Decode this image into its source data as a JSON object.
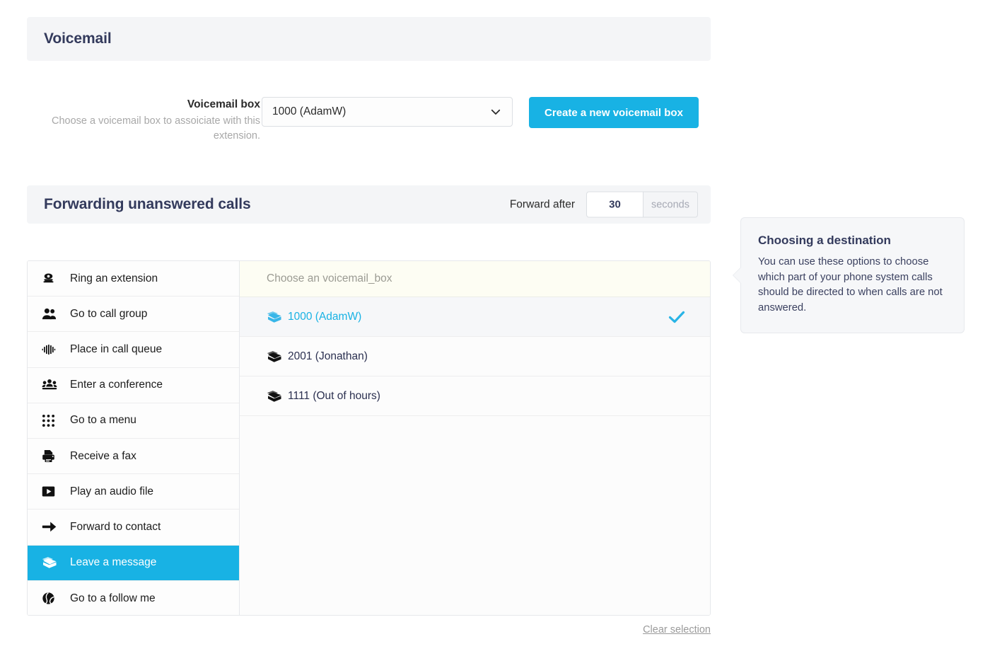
{
  "voicemail_section": {
    "title": "Voicemail",
    "field_label": "Voicemail box",
    "field_help": "Choose a voicemail box to assoiciate with this extension.",
    "selected_box": "1000 (AdamW)",
    "create_button": "Create a new voicemail box"
  },
  "forwarding_section": {
    "title": "Forwarding unanswered calls",
    "forward_after_label": "Forward after",
    "forward_after_value": "30",
    "forward_after_unit": "seconds"
  },
  "destinations": [
    {
      "label": "Ring an extension",
      "icon": "telephone-icon",
      "active": false
    },
    {
      "label": "Go to call group",
      "icon": "users-icon",
      "active": false
    },
    {
      "label": "Place in call queue",
      "icon": "signal-bars-icon",
      "active": false
    },
    {
      "label": "Enter a conference",
      "icon": "conference-icon",
      "active": false
    },
    {
      "label": "Go to a menu",
      "icon": "keypad-grid-icon",
      "active": false
    },
    {
      "label": "Receive a fax",
      "icon": "fax-icon",
      "active": false
    },
    {
      "label": "Play an audio file",
      "icon": "play-icon",
      "active": false
    },
    {
      "label": "Forward to contact",
      "icon": "arrow-right-icon",
      "active": false
    },
    {
      "label": "Leave a message",
      "icon": "envelopes-icon",
      "active": true
    },
    {
      "label": "Go to a follow me",
      "icon": "globe-icon",
      "active": false
    }
  ],
  "detail_panel": {
    "header": "Choose an voicemail_box",
    "options": [
      {
        "label": "1000 (AdamW)",
        "icon": "envelopes-icon",
        "selected": true
      },
      {
        "label": "2001 (Jonathan)",
        "icon": "envelopes-icon",
        "selected": false
      },
      {
        "label": "1111 (Out of hours)",
        "icon": "envelopes-icon",
        "selected": false
      }
    ],
    "clear_selection": "Clear selection"
  },
  "tooltip": {
    "title": "Choosing a destination",
    "body": "You can use these options to choose which part of your phone system calls should be directed to when calls are not answered."
  },
  "colors": {
    "accent": "#18b2e4",
    "heading": "#333a5c",
    "band": "#f4f5f7",
    "detail_header_bg": "#fdfdf3"
  }
}
